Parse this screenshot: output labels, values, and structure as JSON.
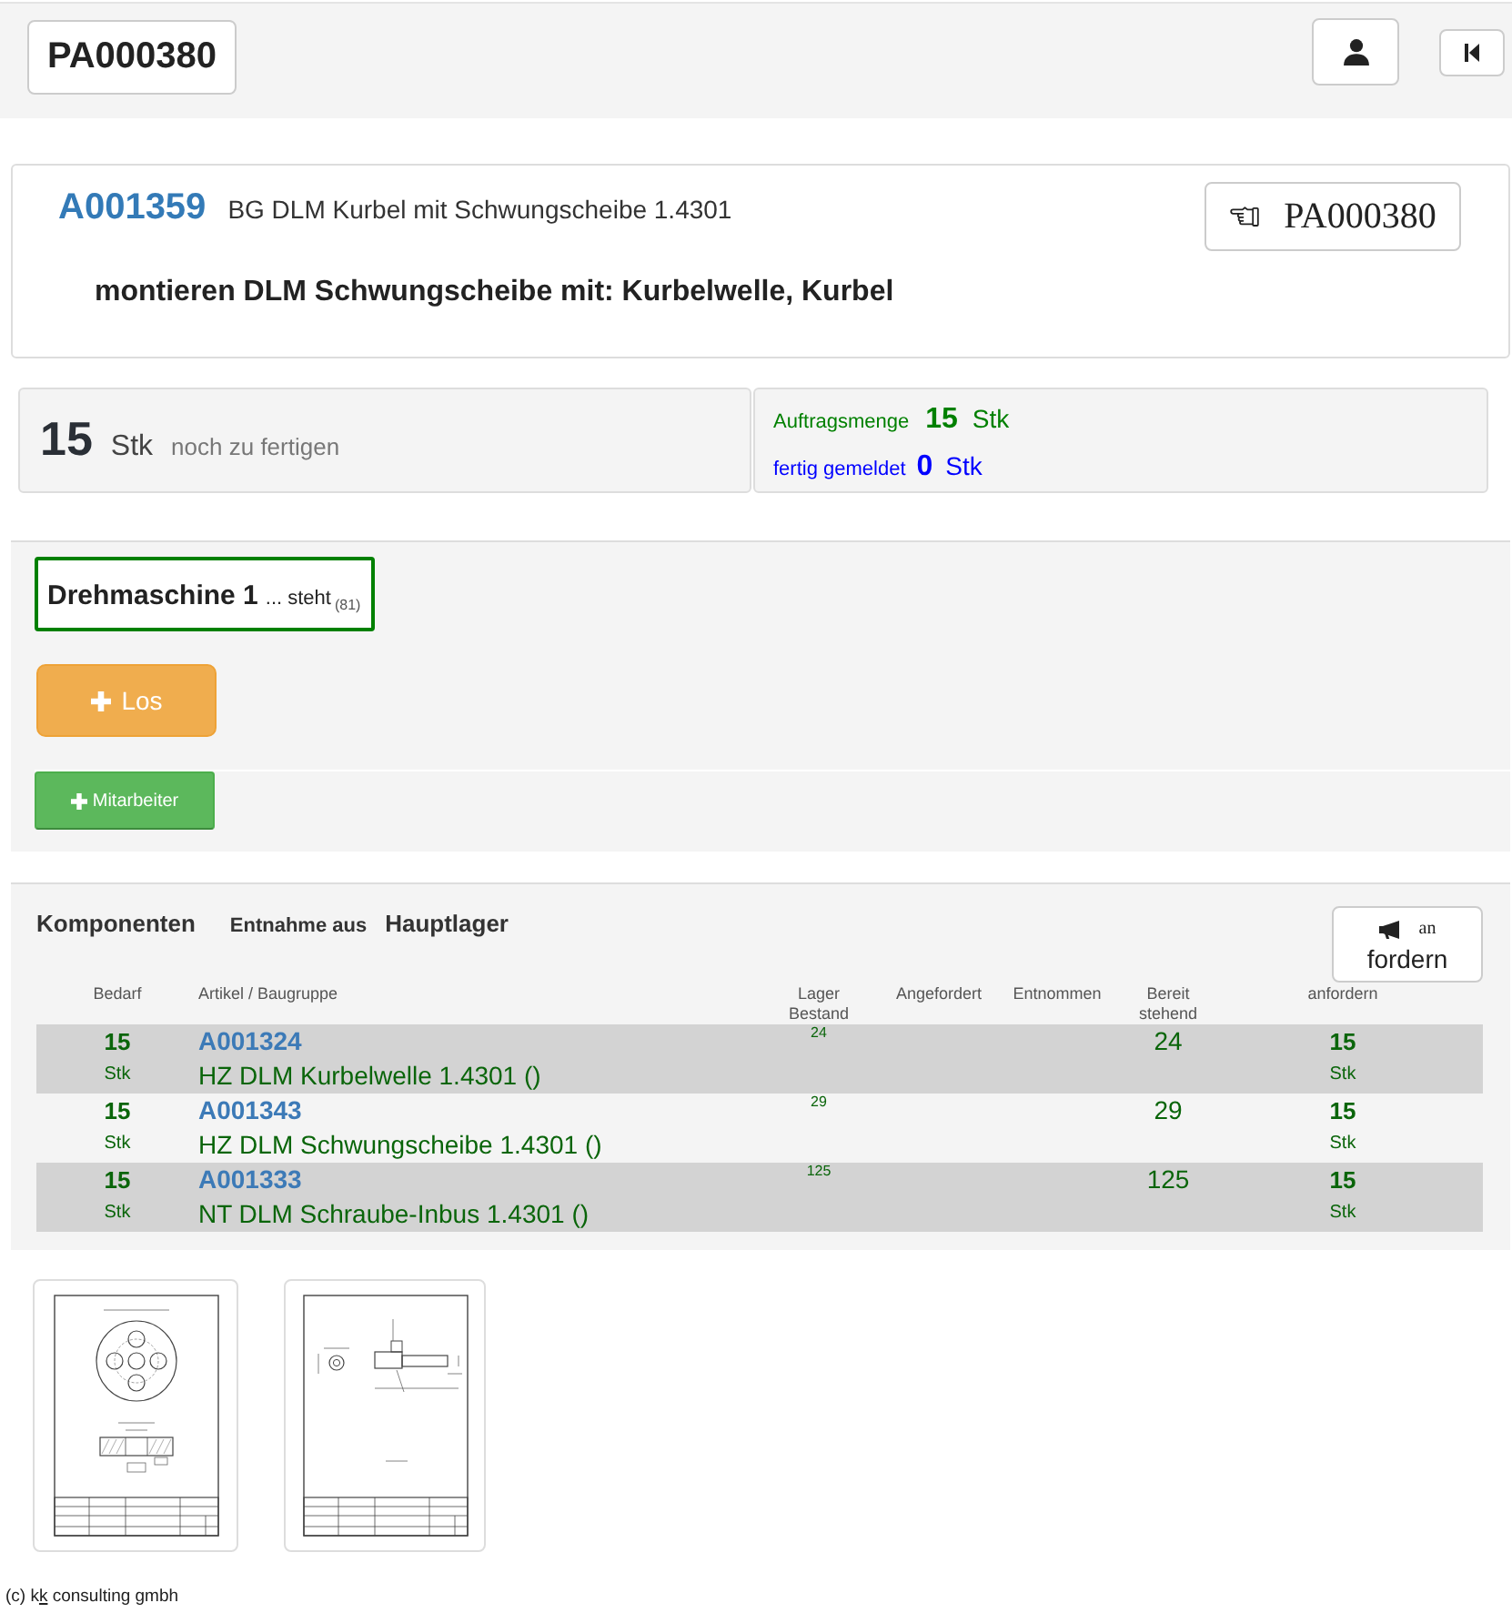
{
  "top_bar": {
    "order_button": "PA000380"
  },
  "header_card": {
    "article_number": "A001359",
    "article_name": "BG DLM Kurbel mit Schwungscheibe 1.4301",
    "order_button": "PA000380",
    "operation": "montieren DLM Schwungscheibe mit: Kurbelwelle, Kurbel"
  },
  "quantities": {
    "remaining": {
      "value": "15",
      "unit": "Stk",
      "label": "noch zu fertigen"
    },
    "ordered": {
      "label": "Auftragsmenge",
      "value": "15",
      "unit": "Stk"
    },
    "reported": {
      "label": "fertig gemeldet",
      "value": "0",
      "unit": "Stk"
    }
  },
  "machine": {
    "name": "Drehmaschine 1",
    "status": "... steht",
    "code": "(81)",
    "buttons": [
      {
        "kind": "warning",
        "label": "Los"
      },
      {
        "kind": "success",
        "label": "Mitarbeiter"
      }
    ]
  },
  "components": {
    "title": "Komponenten",
    "source_label": "Entnahme aus",
    "source": "Hauptlager",
    "request_button": {
      "small_label": "an",
      "label": "fordern"
    },
    "columns": [
      "Bedarf",
      "Artikel / Baugruppe",
      "Lager Bestand",
      "Angefordert",
      "Entnommen",
      "Bereit stehend",
      "anfordern"
    ],
    "rows": [
      {
        "demand": "15",
        "demand_unit": "Stk",
        "article_number": "A001324",
        "article_name": "HZ DLM Kurbelwelle 1.4301 ()",
        "stock": "24",
        "ready": "24",
        "request": "15",
        "request_unit": "Stk"
      },
      {
        "demand": "15",
        "demand_unit": "Stk",
        "article_number": "A001343",
        "article_name": "HZ DLM Schwungscheibe 1.4301 ()",
        "stock": "29",
        "ready": "29",
        "request": "15",
        "request_unit": "Stk"
      },
      {
        "demand": "15",
        "demand_unit": "Stk",
        "article_number": "A001333",
        "article_name": "NT DLM Schraube-Inbus 1.4301 ()",
        "stock": "125",
        "ready": "125",
        "request": "15",
        "request_unit": "Stk"
      }
    ]
  },
  "drawings": [
    {
      "kind": "disc"
    },
    {
      "kind": "shaft"
    }
  ],
  "footer": {
    "parts": [
      {
        "text": "(c) k",
        "underline": false
      },
      {
        "text": "k",
        "underline": true
      },
      {
        "text": " consulting gmbh",
        "underline": false
      }
    ]
  }
}
